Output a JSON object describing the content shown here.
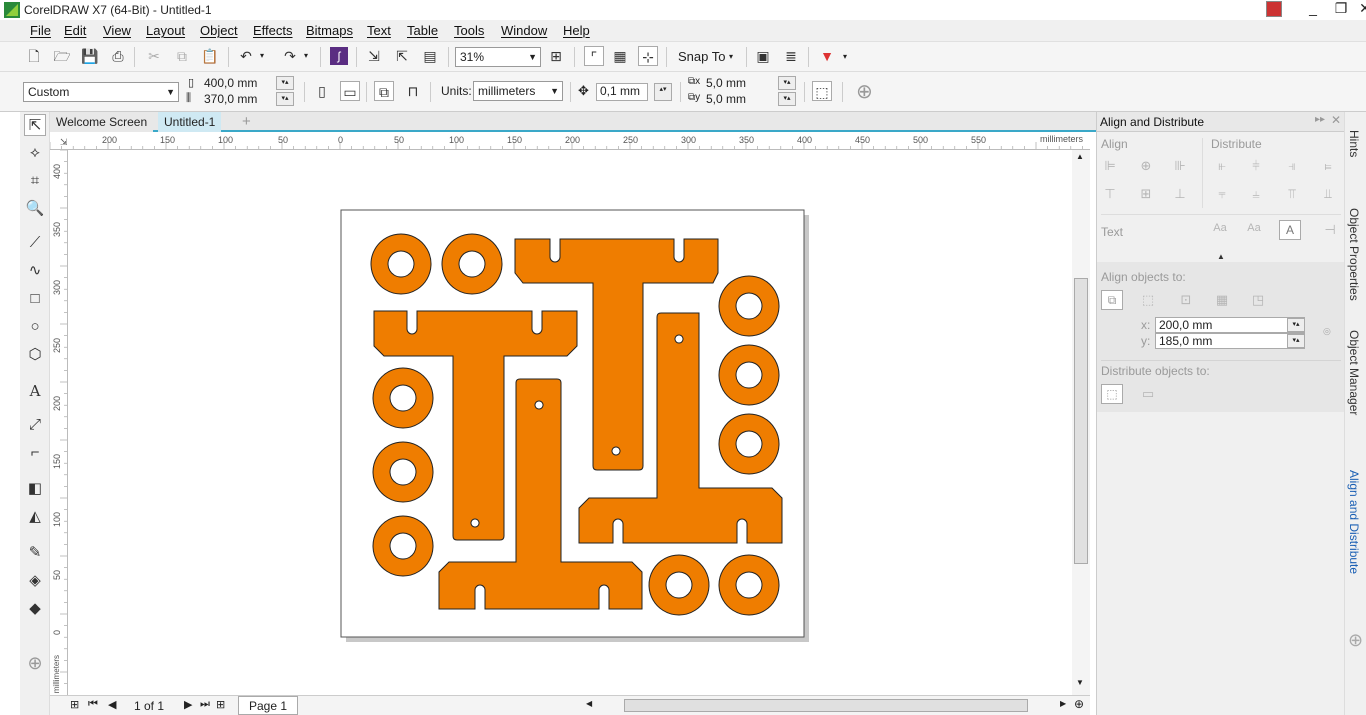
{
  "window": {
    "title": "CorelDRAW X7 (64-Bit) - Untitled-1",
    "controls": [
      "_",
      "❐",
      "✕"
    ]
  },
  "menu": [
    "File",
    "Edit",
    "View",
    "Layout",
    "Object",
    "Effects",
    "Bitmaps",
    "Text",
    "Table",
    "Tools",
    "Window",
    "Help"
  ],
  "toolbar": {
    "zoom": "31%",
    "snap_to": "Snap To"
  },
  "propertybar": {
    "page_preset": "Custom",
    "width": "400,0 mm",
    "height": "370,0 mm",
    "units_label": "Units:",
    "units": "millimeters",
    "nudge": "0,1 mm",
    "dup_x": "5,0 mm",
    "dup_y": "5,0 mm"
  },
  "tabs": {
    "welcome": "Welcome Screen",
    "doc": "Untitled-1",
    "add": "+"
  },
  "ruler": {
    "h_labels": [
      "200",
      "150",
      "100",
      "50",
      "0",
      "50",
      "100",
      "150",
      "200",
      "250",
      "300",
      "350",
      "400",
      "450",
      "500",
      "550"
    ],
    "h_unit": "millimeters",
    "v_labels": [
      "400",
      "350",
      "300",
      "250",
      "200",
      "150",
      "100",
      "50",
      "0"
    ],
    "v_unit": "millimeters"
  },
  "pagenav": {
    "count": "1 of 1",
    "page": "Page 1"
  },
  "docker": {
    "title": "Align and Distribute",
    "align": "Align",
    "distribute": "Distribute",
    "text": "Text",
    "align_to": "Align objects to:",
    "x_label": "x:",
    "x_value": "200,0 mm",
    "y_label": "y:",
    "y_value": "185,0 mm",
    "distribute_to": "Distribute objects to:"
  },
  "docker_tabs": [
    "Hints",
    "Object Properties",
    "Object Manager",
    "Align and Distribute"
  ],
  "colors": {
    "shape_fill": "#ef7d00",
    "accent": "#3aa8c8"
  }
}
